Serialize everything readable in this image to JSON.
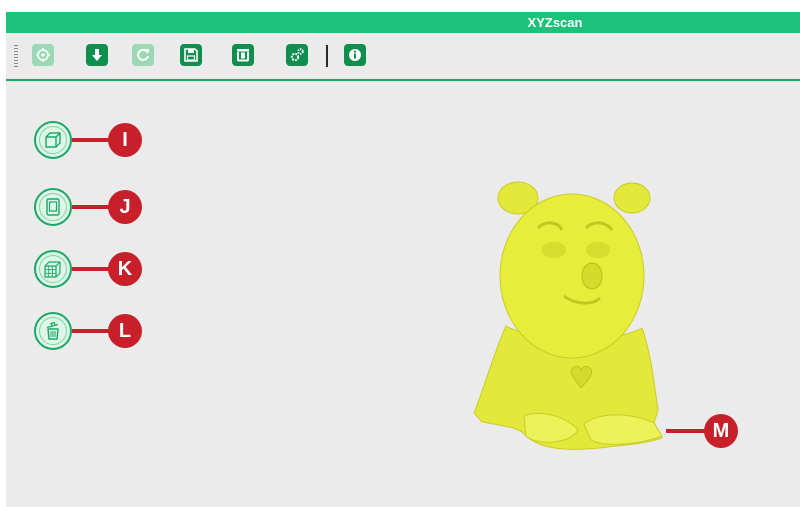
{
  "window": {
    "title": "XYZscan"
  },
  "toolbar": {
    "buttons": [
      {
        "name": "target-button",
        "icon": "crosshair-icon",
        "enabled": false
      },
      {
        "name": "download-button",
        "icon": "download-arrow-icon",
        "enabled": true
      },
      {
        "name": "refresh-button",
        "icon": "refresh-icon",
        "enabled": false
      },
      {
        "name": "save-button",
        "icon": "floppy-disk-icon",
        "enabled": true
      },
      {
        "name": "print-button",
        "icon": "printer-figure-icon",
        "enabled": true
      },
      {
        "name": "settings-button",
        "icon": "gears-icon",
        "enabled": true
      },
      {
        "name": "info-button",
        "icon": "info-icon",
        "enabled": true
      }
    ]
  },
  "sidebar": {
    "items": [
      {
        "icon": "cube-icon",
        "callout": "I"
      },
      {
        "icon": "tablet-icon",
        "callout": "J"
      },
      {
        "icon": "grid-cube-icon",
        "callout": "K"
      },
      {
        "icon": "trash-icon",
        "callout": "L"
      }
    ]
  },
  "viewport": {
    "model_color": "#e8ec3a",
    "callout": "M"
  },
  "colors": {
    "accent": "#1cc27a",
    "dark_green": "#0e8f4d",
    "callout_red": "#c8202a"
  }
}
